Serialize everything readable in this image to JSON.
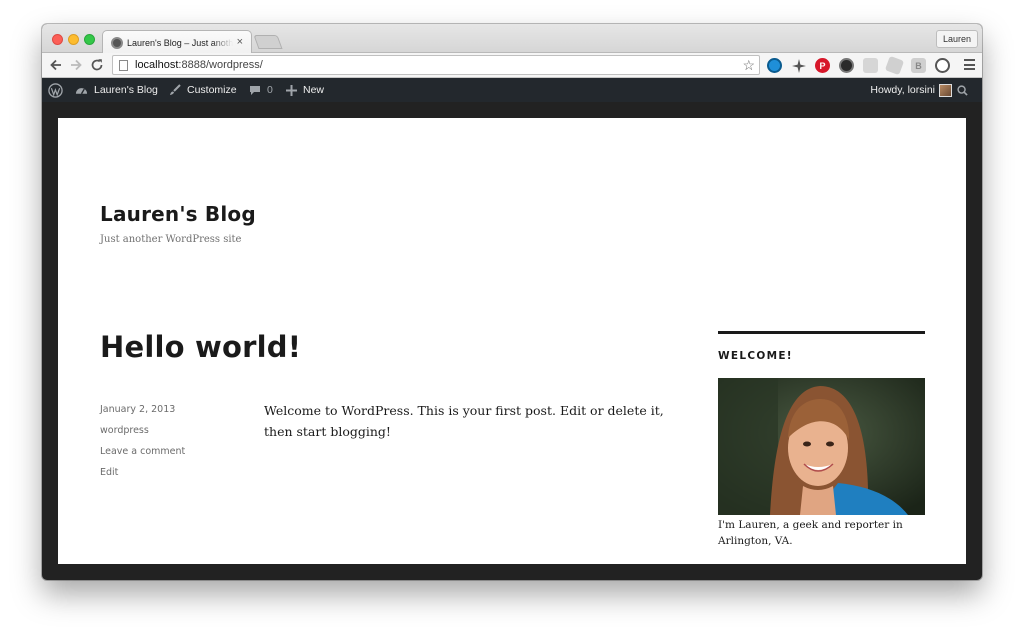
{
  "browser": {
    "tab_title": "Lauren's Blog – Just another WordPress site",
    "tab_close": "×",
    "profile_name": "Lauren",
    "url_host": "localhost",
    "url_path": ":8888/wordpress/",
    "star_glyph": "☆"
  },
  "adminbar": {
    "site_name": "Lauren's Blog",
    "customize": "Customize",
    "comments_count": "0",
    "new_label": "New",
    "howdy": "Howdy, lorsini"
  },
  "site": {
    "title": "Lauren's Blog",
    "description": "Just another WordPress site"
  },
  "post": {
    "title": "Hello world!",
    "date": "January 2, 2013",
    "author": "wordpress",
    "comment_link": "Leave a comment",
    "edit_link": "Edit",
    "body": "Welcome to WordPress. This is your first post. Edit or delete it, then start blogging!"
  },
  "widget": {
    "title": "WELCOME!",
    "caption": "I'm Lauren, a geek and reporter in Arlington, VA."
  },
  "colors": {
    "adminbar_bg": "#23282d",
    "frame_bg": "#222222",
    "text": "#1a1a1a",
    "meta": "#6b6b6b"
  }
}
